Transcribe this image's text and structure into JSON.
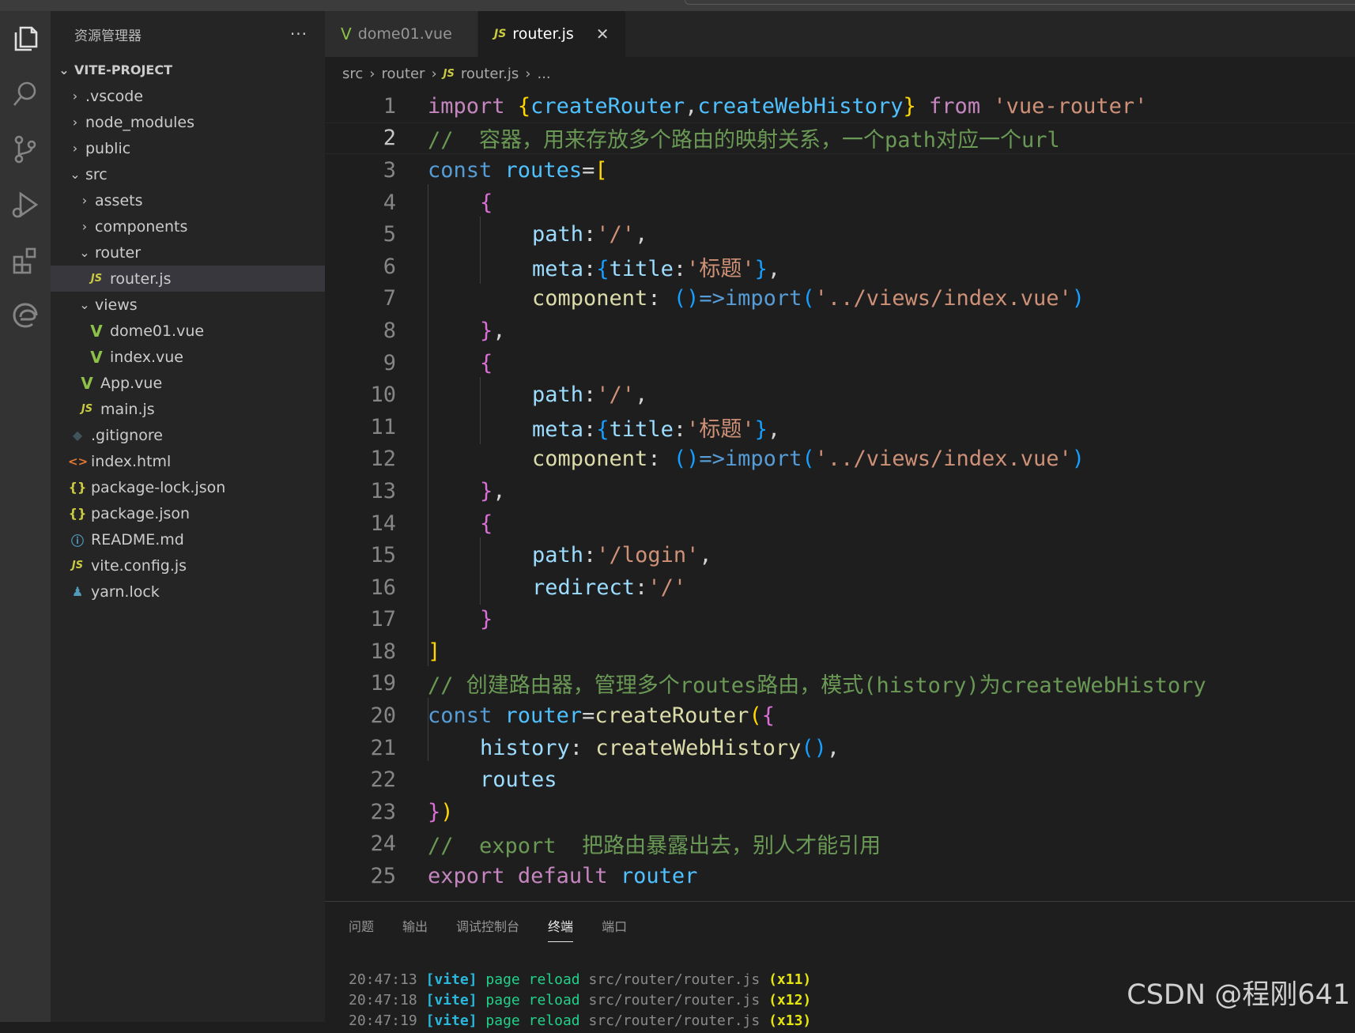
{
  "sidebar": {
    "title": "资源管理器",
    "more": "···",
    "project": "VITE-PROJECT",
    "items": [
      {
        "label": ".vscode",
        "chev": "›"
      },
      {
        "label": "node_modules",
        "chev": "›"
      },
      {
        "label": "public",
        "chev": "›"
      },
      {
        "label": "src",
        "chev": "⌄"
      },
      {
        "label": "assets",
        "chev": "›"
      },
      {
        "label": "components",
        "chev": "›"
      },
      {
        "label": "router",
        "chev": "⌄"
      },
      {
        "label": "router.js",
        "icon": "JS"
      },
      {
        "label": "views",
        "chev": "⌄"
      },
      {
        "label": "dome01.vue",
        "icon": "V"
      },
      {
        "label": "index.vue",
        "icon": "V"
      },
      {
        "label": "App.vue",
        "icon": "V"
      },
      {
        "label": "main.js",
        "icon": "JS"
      },
      {
        "label": ".gitignore",
        "icon": "◆"
      },
      {
        "label": "index.html",
        "icon": "<>"
      },
      {
        "label": "package-lock.json",
        "icon": "{}"
      },
      {
        "label": "package.json",
        "icon": "{}"
      },
      {
        "label": "README.md",
        "icon": "ⓘ"
      },
      {
        "label": "vite.config.js",
        "icon": "JS"
      },
      {
        "label": "yarn.lock",
        "icon": "♟"
      }
    ]
  },
  "tabs": [
    {
      "label": "dome01.vue",
      "icon": "V"
    },
    {
      "label": "router.js",
      "icon": "JS",
      "close": "✕"
    }
  ],
  "breadcrumb": [
    "src",
    "router",
    "JS",
    "router.js",
    "..."
  ],
  "breadcrumb_sep": "›",
  "code": {
    "line_numbers": [
      "1",
      "2",
      "3",
      "4",
      "5",
      "6",
      "7",
      "8",
      "9",
      "10",
      "11",
      "12",
      "13",
      "14",
      "15",
      "16",
      "17",
      "18",
      "19",
      "20",
      "21",
      "22",
      "23",
      "24",
      "25"
    ],
    "l1": [
      "import",
      " ",
      "{",
      "createRouter",
      ",",
      "createWebHistory",
      "}",
      " ",
      "from",
      " ",
      "'vue-router'"
    ],
    "l2": "//  容器，用来存放多个路由的映射关系，一个path对应一个url",
    "l3": [
      "const",
      " ",
      "routes",
      "=",
      "["
    ],
    "l4": "{",
    "l5": [
      "path",
      ":",
      "'/'",
      ","
    ],
    "l6": [
      "meta",
      ":",
      "{",
      "title",
      ":",
      "'标题'",
      "}",
      ","
    ],
    "l7": [
      "component",
      ": ",
      "()",
      "=>",
      "import",
      "(",
      "'../views/index.vue'",
      ")"
    ],
    "l8": [
      "}",
      ","
    ],
    "l9": "{",
    "l10": [
      "path",
      ":",
      "'/'",
      ","
    ],
    "l11": [
      "meta",
      ":",
      "{",
      "title",
      ":",
      "'标题'",
      "}",
      ","
    ],
    "l12": [
      "component",
      ": ",
      "()",
      "=>",
      "import",
      "(",
      "'../views/index.vue'",
      ")"
    ],
    "l13": [
      "}",
      ","
    ],
    "l14": "{",
    "l15": [
      "path",
      ":",
      "'/login'",
      ","
    ],
    "l16": [
      "redirect",
      ":",
      "'/'"
    ],
    "l17": "}",
    "l18": "]",
    "l19": "// 创建路由器，管理多个routes路由，模式(history)为createWebHistory",
    "l20": [
      "const",
      " ",
      "router",
      "=",
      "createRouter",
      "(",
      "{"
    ],
    "l21": [
      "history",
      ": ",
      "createWebHistory",
      "()",
      ","
    ],
    "l22": "routes",
    "l23": [
      "}",
      ")"
    ],
    "l24": "//  export  把路由暴露出去，别人才能引用",
    "l25": [
      "export",
      " ",
      "default",
      " ",
      "router"
    ]
  },
  "panel": {
    "tabs": [
      "问题",
      "输出",
      "调试控制台",
      "终端",
      "端口"
    ],
    "active": "终端",
    "terminal": [
      {
        "time": "20:47:13",
        "tag": "[vite]",
        "msg": "page reload",
        "path": "src/router/router.js",
        "count": "(x11)"
      },
      {
        "time": "20:47:18",
        "tag": "[vite]",
        "msg": "page reload",
        "path": "src/router/router.js",
        "count": "(x12)"
      },
      {
        "time": "20:47:19",
        "tag": "[vite]",
        "msg": "page reload",
        "path": "src/router/router.js",
        "count": "(x13)"
      }
    ]
  },
  "watermark": "CSDN @程刚641"
}
